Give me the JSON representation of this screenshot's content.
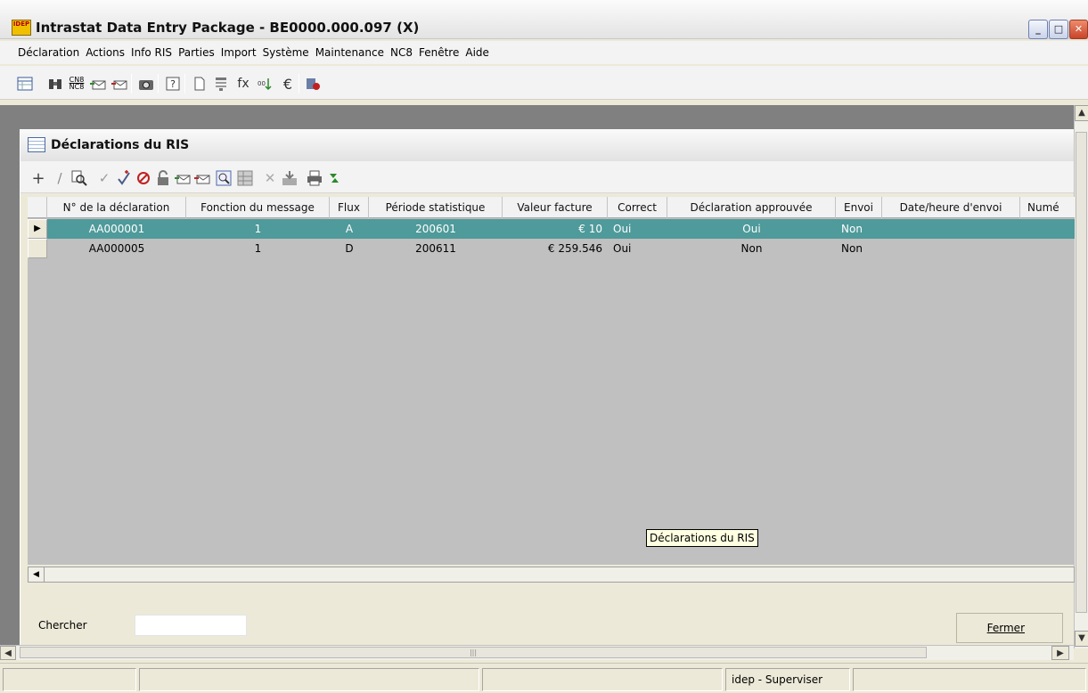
{
  "window": {
    "logo_text": "IDEP",
    "title": "Intrastat Data Entry Package - BE0000.000.097 (X)",
    "minimize": "_",
    "maximize": "□",
    "close": "✕"
  },
  "menu": [
    "Déclaration",
    "Actions",
    "Info RIS",
    "Parties",
    "Import",
    "Système",
    "Maintenance",
    "NC8",
    "Fenêtre",
    "Aide"
  ],
  "toolbar": {
    "icons": [
      "table-icon",
      "binoculars-icon",
      "cn8-nc8-icon",
      "send-envelope-icon",
      "receive-envelope-icon",
      "camera-icon",
      "help-icon",
      "new-document-icon",
      "filter-icon",
      "function-icon",
      "decimal-icon",
      "euro-icon",
      "exit-icon"
    ],
    "cn8_text": "CN8/NC8",
    "fx_text": "fx",
    "euro_text": "€"
  },
  "child": {
    "title": "Déclarations du RIS",
    "toolbar_icons": [
      "add-icon",
      "edit-icon",
      "search-icon",
      "check-icon",
      "validate-icon",
      "cancel-icon",
      "lock-icon",
      "envelope-send-icon",
      "envelope-receive-icon",
      "preview-icon",
      "grid-icon",
      "delete-icon",
      "import-icon",
      "print-icon",
      "refresh-icon"
    ]
  },
  "grid": {
    "columns": [
      "N° de la déclaration",
      "Fonction du message",
      "Flux",
      "Période statistique",
      "Valeur facture",
      "Correct",
      "Déclaration approuvée",
      "Envoi",
      "Date/heure d'envoi",
      "Numé"
    ],
    "rows": [
      [
        "AA000001",
        "1",
        "A",
        "200601",
        "€ 10",
        "Oui",
        "Oui",
        "Non",
        "",
        ""
      ],
      [
        "AA000005",
        "1",
        "D",
        "200611",
        "€ 259.546",
        "Oui",
        "Non",
        "Non",
        "",
        ""
      ]
    ],
    "selected_row": 0,
    "row_marker": "▶"
  },
  "tooltip": "Déclarations du RIS",
  "search": {
    "label": "Chercher",
    "value": ""
  },
  "close_button": "Fermer",
  "statusbar": [
    "",
    "",
    "",
    "idep - Superviser",
    ""
  ],
  "colors": {
    "selection": "#4f9a9a",
    "mdi_background": "#808080",
    "grid_background": "#c0c0c0"
  }
}
